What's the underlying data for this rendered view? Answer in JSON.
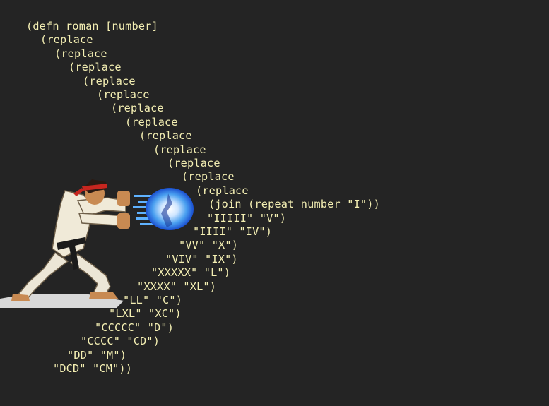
{
  "slide": {
    "background_color": "#242424",
    "text_color": "#f4efb3",
    "code_lines": [
      "(defn roman [number]",
      "(replace",
      "(replace",
      "(replace",
      "(replace",
      "(replace",
      "(replace",
      "(replace",
      "(replace",
      "(replace",
      "(replace",
      "(replace",
      "(replace",
      "(join (repeat number \"I\"))",
      "\"IIIII\" \"V\")",
      "\"IIII\" \"IV\")",
      "\"VV\" \"X\")",
      "\"VIV\" \"IX\")",
      "\"XXXXX\" \"L\")",
      "\"XXXX\" \"XL\")",
      "\"LL\" \"C\")",
      "\"LXL\" \"XC\")",
      "\"CCCCC\" \"D\")",
      "\"CCCC\" \"CD\")",
      "\"DD\" \"M\")",
      "\"DCD\" \"CM\"))"
    ],
    "illustration": {
      "icon": "fighter-hadouken-icon",
      "projectile_icon": "energy-fireball-icon"
    }
  }
}
